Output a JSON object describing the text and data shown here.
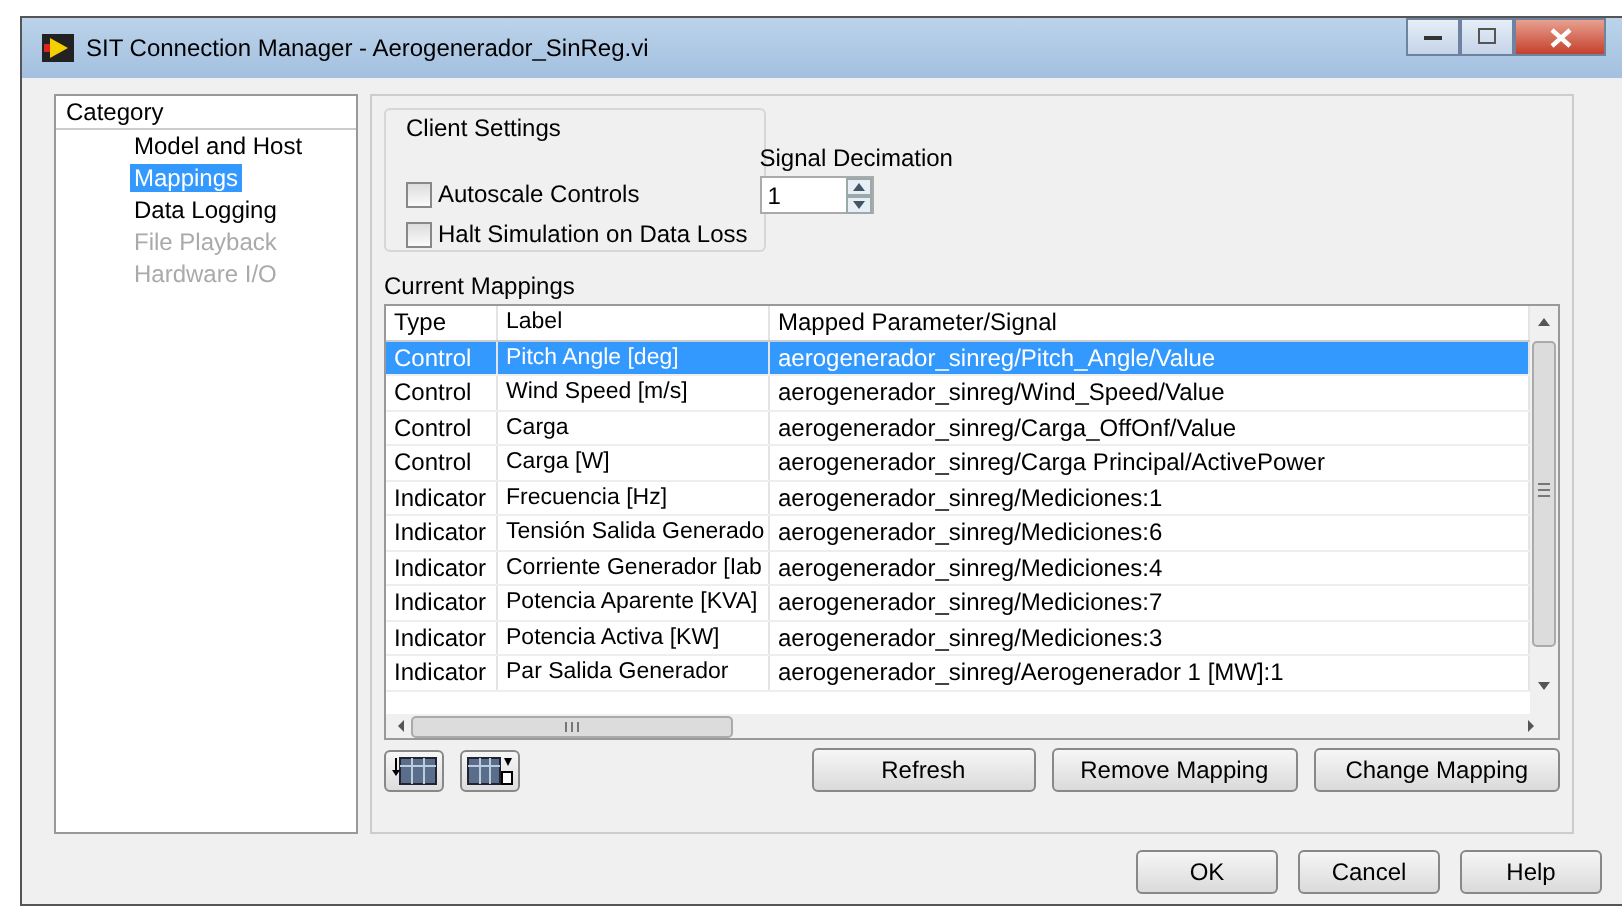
{
  "window": {
    "title": "SIT Connection Manager - Aerogenerador_SinReg.vi"
  },
  "category": {
    "title": "Category",
    "items": [
      {
        "label": "Model and Host",
        "selected": false,
        "disabled": false
      },
      {
        "label": "Mappings",
        "selected": true,
        "disabled": false
      },
      {
        "label": "Data Logging",
        "selected": false,
        "disabled": false
      },
      {
        "label": "File Playback",
        "selected": false,
        "disabled": true
      },
      {
        "label": "Hardware I/O",
        "selected": false,
        "disabled": true
      }
    ]
  },
  "client_settings": {
    "title": "Client Settings",
    "checkboxes": [
      {
        "label": "Autoscale Controls",
        "checked": false
      },
      {
        "label": "Halt Simulation on Data Loss",
        "checked": false
      }
    ],
    "signal_decimation": {
      "label": "Signal Decimation",
      "value": "1"
    }
  },
  "mappings": {
    "title": "Current Mappings",
    "columns": [
      "Type",
      "Label",
      "Mapped Parameter/Signal"
    ],
    "rows": [
      {
        "type": "Control",
        "label": "Pitch Angle [deg]",
        "signal": "aerogenerador_sinreg/Pitch_Angle/Value",
        "selected": true
      },
      {
        "type": "Control",
        "label": "Wind Speed [m/s]",
        "signal": "aerogenerador_sinreg/Wind_Speed/Value",
        "selected": false
      },
      {
        "type": "Control",
        "label": "Carga",
        "signal": "aerogenerador_sinreg/Carga_OffOnf/Value",
        "selected": false
      },
      {
        "type": "Control",
        "label": "Carga [W]",
        "signal": "aerogenerador_sinreg/Carga Principal/ActivePower",
        "selected": false
      },
      {
        "type": "Indicator",
        "label": "Frecuencia [Hz]",
        "signal": "aerogenerador_sinreg/Mediciones:1",
        "selected": false
      },
      {
        "type": "Indicator",
        "label": "Tensión Salida Generado",
        "signal": "aerogenerador_sinreg/Mediciones:6",
        "selected": false
      },
      {
        "type": "Indicator",
        "label": "Corriente Generador [Iab",
        "signal": "aerogenerador_sinreg/Mediciones:4",
        "selected": false
      },
      {
        "type": "Indicator",
        "label": "Potencia Aparente [KVA]",
        "signal": "aerogenerador_sinreg/Mediciones:7",
        "selected": false
      },
      {
        "type": "Indicator",
        "label": "Potencia Activa [KW]",
        "signal": "aerogenerador_sinreg/Mediciones:3",
        "selected": false
      },
      {
        "type": "Indicator",
        "label": "Par Salida Generador",
        "signal": "aerogenerador_sinreg/Aerogenerador 1 [MW]:1",
        "selected": false
      }
    ],
    "actions": [
      "Refresh",
      "Remove Mapping",
      "Change Mapping"
    ]
  },
  "dialog_buttons": [
    "OK",
    "Cancel",
    "Help"
  ]
}
